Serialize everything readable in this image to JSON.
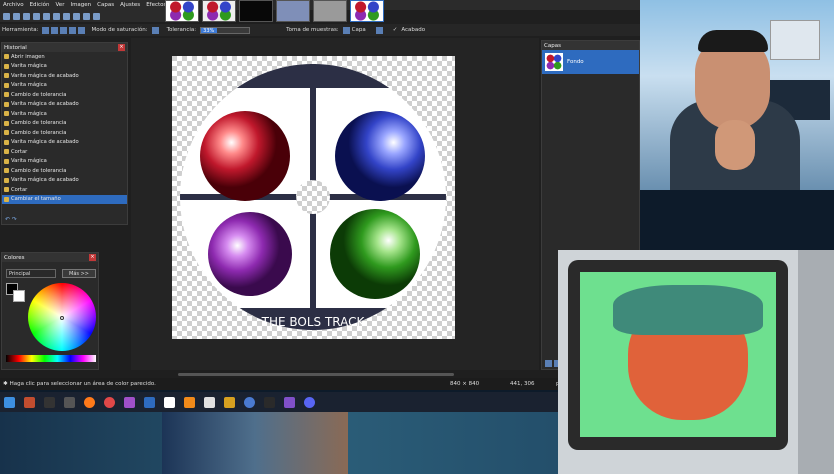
{
  "menu": [
    "Archivo",
    "Edición",
    "Ver",
    "Imagen",
    "Capas",
    "Ajustes",
    "Efectos"
  ],
  "toolbar": {
    "herramienta_label": "Herramienta:",
    "modo_label": "Modo de saturación:",
    "tolerancia_label": "Tolerancia:",
    "tolerancia_value": "33%",
    "tolerancia_fraction": 0.33,
    "toma_label": "Toma de muestras:",
    "toma_value": "Capa",
    "acabado_label": "Acabado"
  },
  "historial": {
    "title": "Historial",
    "items": [
      "Abrir imagen",
      "Varita mágica",
      "Varita mágica de acabado",
      "Varita mágica",
      "Cambio de tolerancia",
      "Varita mágica de acabado",
      "Varita mágica",
      "Cambio de tolerancia",
      "Cambio de tolerancia",
      "Varita mágica de acabado",
      "Cortar",
      "Varita mágica",
      "Cambio de tolerancia",
      "Varita mágica de acabado",
      "Cortar",
      "Cambiar el tamaño"
    ],
    "selected_index": 15
  },
  "colores": {
    "title": "Colores",
    "mode": "Principal",
    "more_button": "Más >>"
  },
  "capas": {
    "title": "Capas",
    "layer_name": "Fondo"
  },
  "image": {
    "caption": "THE BOLS TRACK"
  },
  "status": {
    "hint": "Haga clic para seleccionar un área de color parecido.",
    "size": "840 × 840",
    "coords": "441, 306",
    "unit": "px"
  },
  "colors": {
    "accent": "#2e6bbf",
    "red_ball": "#c0182c",
    "blue_ball": "#3344c8",
    "purple_ball": "#8e2ab0",
    "green_ball": "#2f9a1e"
  }
}
